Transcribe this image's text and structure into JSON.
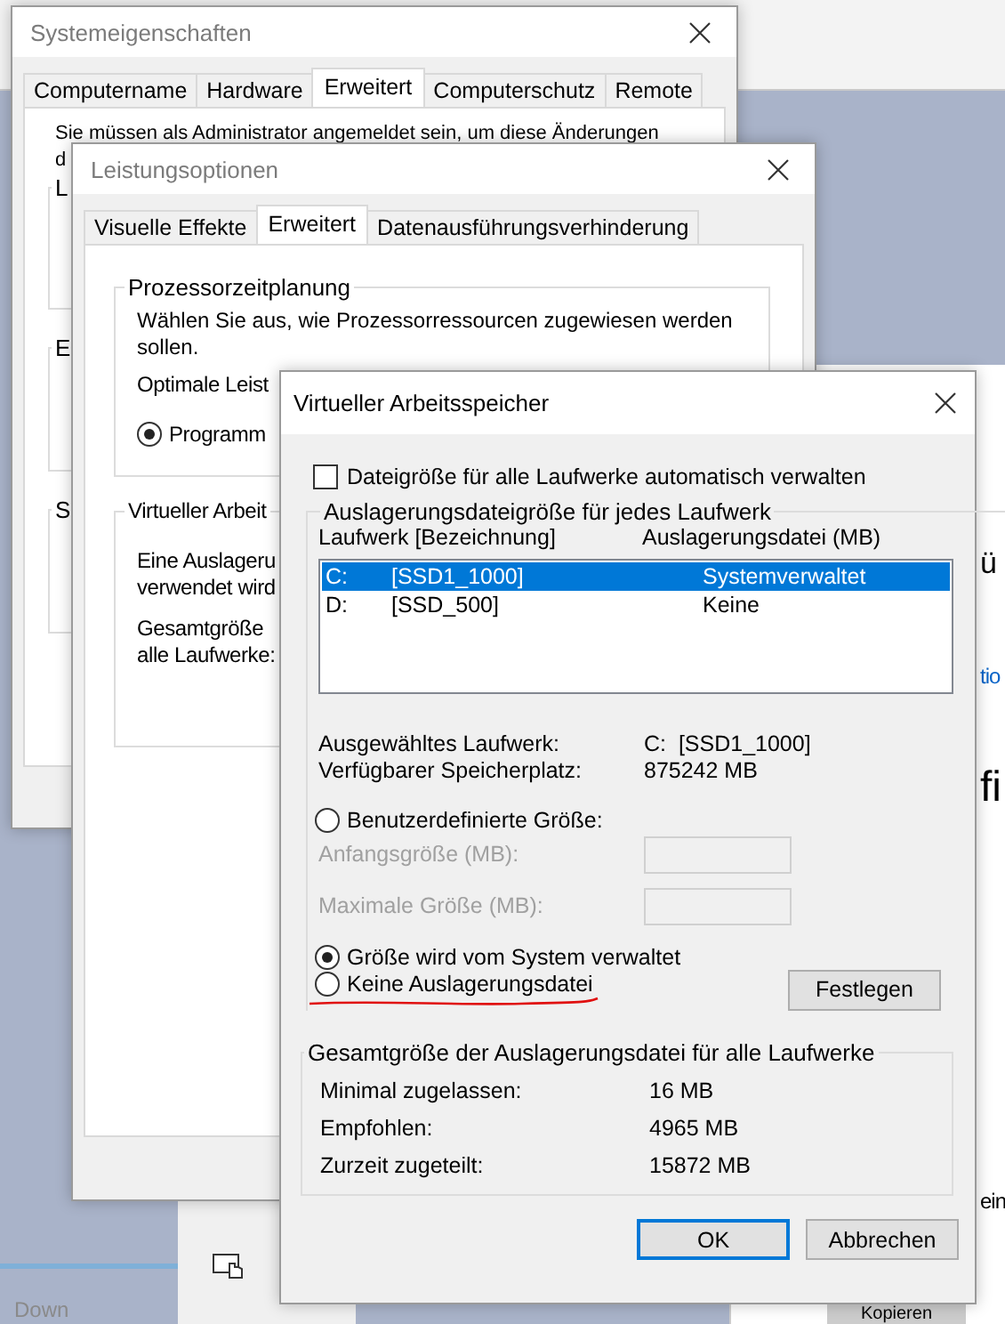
{
  "background_window": {
    "fragments": [
      {
        "text": "ü",
        "kind": "text"
      },
      {
        "text": "tio",
        "kind": "link"
      },
      {
        "text": "fi",
        "kind": "heading"
      },
      {
        "text": "ein",
        "kind": "text"
      }
    ],
    "button": "Kopieren"
  },
  "taskbar_fragment": {
    "text": "Down"
  },
  "system_properties": {
    "title": "Systemeigenschaften",
    "tabs": [
      {
        "label": "Computername",
        "selected": false
      },
      {
        "label": "Hardware",
        "selected": false
      },
      {
        "label": "Erweitert",
        "selected": true
      },
      {
        "label": "Computerschutz",
        "selected": false
      },
      {
        "label": "Remote",
        "selected": false
      }
    ],
    "notice": [
      "Sie müssen als Administrator angemeldet sein, um diese Änderungen",
      "d"
    ],
    "groups": [
      {
        "label": "L"
      },
      {
        "label": "E"
      },
      {
        "label": "S"
      }
    ]
  },
  "performance_options": {
    "title": "Leistungsoptionen",
    "tabs": [
      {
        "label": "Visuelle Effekte",
        "selected": false
      },
      {
        "label": "Erweitert",
        "selected": true
      },
      {
        "label": "Datenausführungsverhinderung",
        "selected": false
      }
    ],
    "scheduling": {
      "label": "Prozessorzeitplanung",
      "text": "Wählen Sie aus, wie Prozessorressourcen zugewiesen werden sollen.",
      "option_label": "Optimale Leist",
      "radio": {
        "label": "Programm",
        "checked": true
      }
    },
    "virtual_memory": {
      "label": "Virtueller Arbeit",
      "texts": [
        "Eine Auslageru",
        "verwendet wird",
        "Gesamtgröße",
        "alle Laufwerke:"
      ]
    }
  },
  "virtual_memory": {
    "title": "Virtueller Arbeitsspeicher",
    "auto_manage": {
      "label": "Dateigröße für alle Laufwerke automatisch verwalten",
      "checked": false
    },
    "per_drive": {
      "label": "Auslagerungsdateigröße für jedes Laufwerk",
      "columns": [
        "Laufwerk [Bezeichnung]",
        "Auslagerungsdatei (MB)"
      ],
      "drives": [
        {
          "letter": "C:",
          "name": "[SSD1_1000]",
          "paging_file": "Systemverwaltet",
          "selected": true
        },
        {
          "letter": "D:",
          "name": "[SSD_500]",
          "paging_file": "Keine",
          "selected": false
        }
      ],
      "selected_drive_label": "Ausgewähltes Laufwerk:",
      "selected_drive": "C:  [SSD1_1000]",
      "free_space_label": "Verfügbarer Speicherplatz:",
      "free_space": "875242 MB",
      "options": [
        {
          "kind": "custom",
          "label": "Benutzerdefinierte Größe:",
          "checked": false
        },
        {
          "kind": "system",
          "label": "Größe wird vom System verwaltet",
          "checked": true
        },
        {
          "kind": "none",
          "label": "Keine Auslagerungsdatei",
          "checked": false,
          "underlined": true
        }
      ],
      "custom_fields": [
        {
          "label": "Anfangsgröße (MB):",
          "disabled": true
        },
        {
          "label": "Maximale Größe (MB):",
          "disabled": true
        }
      ],
      "set_button": "Festlegen"
    },
    "total": {
      "label": "Gesamtgröße der Auslagerungsdatei für alle Laufwerke",
      "rows": [
        {
          "label": "Minimal zugelassen:",
          "value": "16 MB"
        },
        {
          "label": "Empfohlen:",
          "value": "4965 MB"
        },
        {
          "label": "Zurzeit zugeteilt:",
          "value": "15872 MB"
        }
      ]
    },
    "buttons": [
      {
        "label": "OK",
        "default": true
      },
      {
        "label": "Abbrechen",
        "default": false
      }
    ]
  }
}
